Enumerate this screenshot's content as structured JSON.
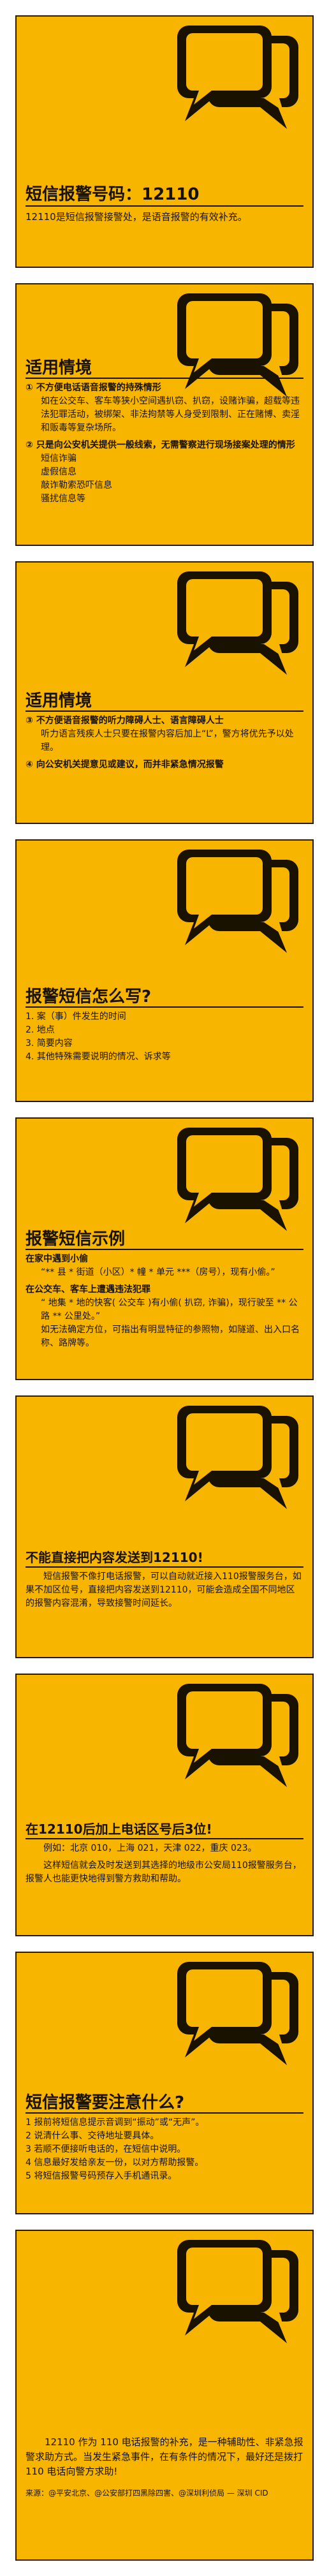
{
  "colors": {
    "panel_bg": "#f7b500",
    "ink": "#1a1200",
    "border": "#2a1c00"
  },
  "icons": {
    "panel_icon": "speech-bubbles-icon"
  },
  "s1": {
    "title": "短信报警号码：12110",
    "text": "12110是短信报警接警处，是语音报警的有效补充。"
  },
  "s2": {
    "title": "适用情境",
    "case1": "① 不方便电话语音报警的持殊情形",
    "case1_text": "如在公交车、客车等狭小空间遇扒窃、扒窃，设赌诈骗，超载等违法犯罪活动，被绑架、非法拘禁等人身受到限制、正在赌博、卖淫和贩毒等复杂场所。",
    "case2": "② 只是向公安机关提供一般线索，无需警察进行现场接案处理的情形",
    "list": [
      "短信诈骗",
      "虚假信息",
      "敲诈勒索恐吓信息",
      "骚扰信息等"
    ]
  },
  "s3": {
    "title": "适用情境",
    "case3": "③ 不方便语音报警的听力障碍人士、语言障碍人士",
    "case3_text": "听力语言残疾人士只要在报警内容后加上“L”，警方将优先予以处理。",
    "case4": "④ 向公安机关提意见或建议，而并非紧急情况报警"
  },
  "s4": {
    "title": "报警短信怎么写?",
    "items": [
      "1. 案（事）件发生的时间",
      "2. 地点",
      "3. 简要内容",
      "4. 其他特殊需要说明的情况、诉求等"
    ]
  },
  "s5": {
    "title": "报警短信示例",
    "ex1_title": "在家中遇到小偷",
    "ex1_text": "“** 县 * 街道（小区）* 幢 * 单元 ***（房号），现有小偷。”",
    "ex2_title": "在公交车、客车上遭遇违法犯罪",
    "ex2_text": "“ 地集 * 地的快客( 公交车 )有小偷( 扒窃, 诈骗)，现行驶至 ** 公路 ** 公里处。”",
    "ex2_note": "如无法确定方位，可指出有明显特征的参照物，如隧道、出入口名称、路牌等。"
  },
  "s6": {
    "title": "不能直接把内容发送到12110!",
    "text": "短信报警不像打电话报警，可以自动就近接入110报警服务台，如果不加区位号，直接把内容发送到12110，可能会造成全国不同地区的报警内容混淆，导致接警时间延长。"
  },
  "s7": {
    "title": "在12110后加上电话区号后3位!",
    "example": "例如：北京 010，上海 021，天津 022，重庆 023。",
    "text": "这样短信就会及时发送到其选择的地级市公安局110报警服务台，报警人也能更快地得到警方救助和帮助。"
  },
  "s8": {
    "title": "短信报警要注意什么?",
    "items": [
      "1 报前将短信息提示音调到“振动”或“无声”。",
      "2 说清什么事、交待地址要具体。",
      "3 若顺不便接听电话的，在短信中说明。",
      "4 信息最好发给亲友一份，以对方帮助报警。",
      "5 将短信报警号码预存入手机通讯录。"
    ]
  },
  "s9": {
    "text": "12110 作为 110 电话报警的补充，是一种辅助性、非紧急报警求助方式。当发生紧急事件，在有条件的情况下，最好还是拨打 110 电话向警方求助!",
    "source": "来源：@平安北京、@公安部打四黑除四害、@深圳利侦局 — 深圳 CID"
  }
}
